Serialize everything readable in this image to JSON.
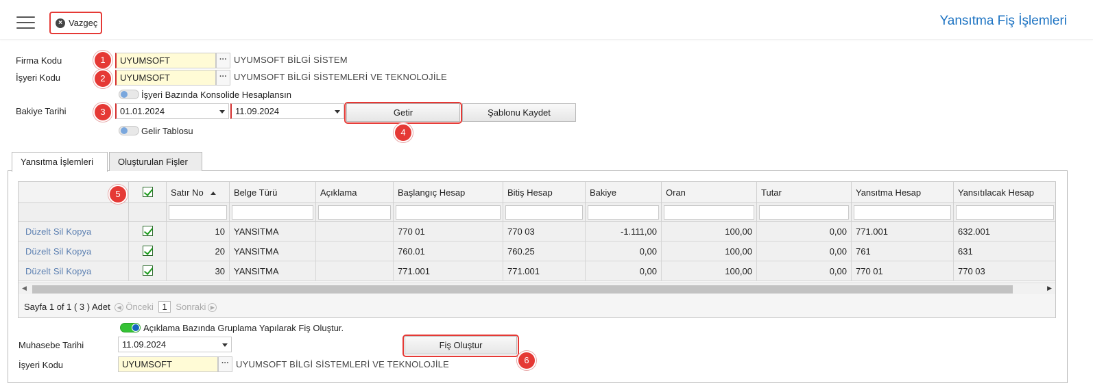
{
  "header": {
    "cancel_label": "Vazgeç",
    "page_title": "Yansıtma Fiş İşlemleri"
  },
  "form": {
    "firma_kodu_label": "Firma Kodu",
    "firma_kodu_value": "UYUMSOFT",
    "firma_kodu_desc": "UYUMSOFT BİLGİ SİSTEM",
    "isyeri_kodu_label": "İşyeri Kodu",
    "isyeri_kodu_value": "UYUMSOFT",
    "isyeri_kodu_desc": "UYUMSOFT BİLGİ SİSTEMLERİ VE TEKNOLOJİLE",
    "konsolide_label": "İşyeri Bazında Konsolide Hesaplansın",
    "bakiye_tarihi_label": "Bakiye Tarihi",
    "start_date": "01.01.2024",
    "end_date": "11.09.2024",
    "getir_label": "Getir",
    "sablon_label": "Şablonu Kaydet",
    "gelir_tablosu_label": "Gelir Tablosu"
  },
  "badges": [
    "1",
    "2",
    "3",
    "4",
    "5",
    "6"
  ],
  "tabs": [
    {
      "label": "Yansıtma İşlemleri"
    },
    {
      "label": "Oluşturulan Fişler"
    }
  ],
  "grid": {
    "columns": [
      "Satır No",
      "Belge Türü",
      "Açıklama",
      "Başlangıç Hesap",
      "Bitiş Hesap",
      "Bakiye",
      "Oran",
      "Tutar",
      "Yansıtma Hesap",
      "Yansıtılacak Hesap"
    ],
    "actions": [
      "Düzelt",
      "Sil",
      "Kopya"
    ],
    "rows": [
      {
        "satir": "10",
        "belge": "YANSITMA",
        "aciklama": "",
        "baslangic": "770 01",
        "bitis": "770 03",
        "bakiye": "-1.111,00",
        "oran": "100,00",
        "tutar": "0,00",
        "yansitma": "771.001",
        "yansitilacak": "632.001"
      },
      {
        "satir": "20",
        "belge": "YANSITMA",
        "aciklama": "",
        "baslangic": "760.01",
        "bitis": "760.25",
        "bakiye": "0,00",
        "oran": "100,00",
        "tutar": "0,00",
        "yansitma": "761",
        "yansitilacak": "631"
      },
      {
        "satir": "30",
        "belge": "YANSITMA",
        "aciklama": "",
        "baslangic": "771.001",
        "bitis": "771.001",
        "bakiye": "0,00",
        "oran": "100,00",
        "tutar": "0,00",
        "yansitma": "770 01",
        "yansitilacak": "770 03"
      }
    ],
    "pager": {
      "info": "Sayfa 1 of 1 ( 3 ) Adet",
      "prev": "Önceki",
      "page": "1",
      "next": "Sonraki"
    }
  },
  "bottom": {
    "gruplama_label": "Açıklama Bazında Gruplama Yapılarak Fiş Oluştur.",
    "muhasebe_tarihi_label": "Muhasebe Tarihi",
    "muhasebe_tarihi_value": "11.09.2024",
    "isyeri_kodu_label": "İşyeri Kodu",
    "isyeri_kodu_value": "UYUMSOFT",
    "isyeri_kodu_desc": "UYUMSOFT BİLGİ SİSTEMLERİ VE TEKNOLOJİLE",
    "fis_olustur_label": "Fiş Oluştur"
  },
  "colors": {
    "accent": "#1b72c2",
    "highlight": "#e53935",
    "input_yellow": "#fffbd6"
  }
}
